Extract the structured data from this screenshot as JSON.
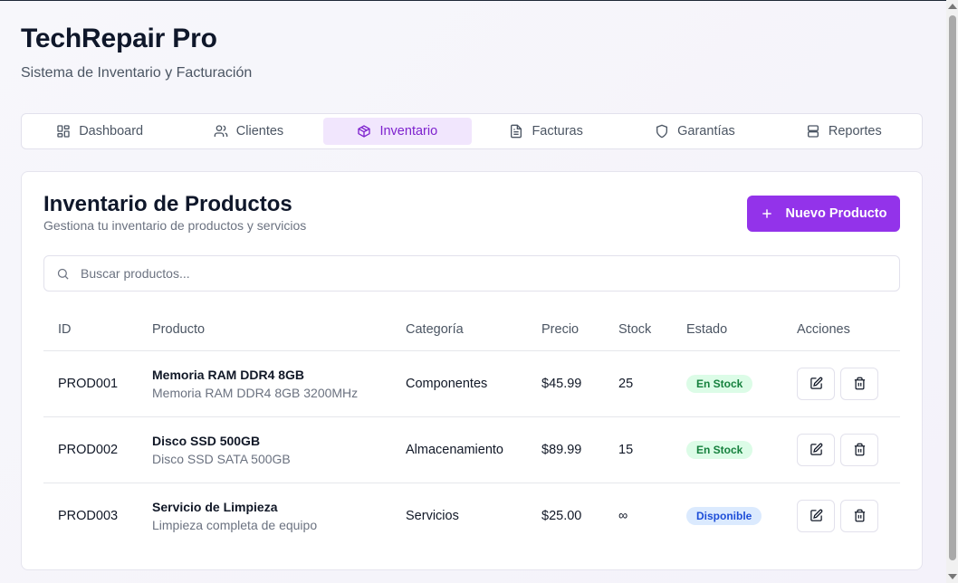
{
  "app": {
    "title": "TechRepair Pro",
    "subtitle": "Sistema de Inventario y Facturación"
  },
  "tabs": [
    {
      "label": "Dashboard",
      "icon": "grid-icon",
      "active": false
    },
    {
      "label": "Clientes",
      "icon": "users-icon",
      "active": false
    },
    {
      "label": "Inventario",
      "icon": "package-icon",
      "active": true
    },
    {
      "label": "Facturas",
      "icon": "document-icon",
      "active": false
    },
    {
      "label": "Garantías",
      "icon": "shield-icon",
      "active": false
    },
    {
      "label": "Reportes",
      "icon": "server-icon",
      "active": false
    }
  ],
  "inventory": {
    "title": "Inventario de Productos",
    "subtitle": "Gestiona tu inventario de productos y servicios",
    "new_button_label": "Nuevo Producto",
    "search_placeholder": "Buscar productos..."
  },
  "table": {
    "headers": [
      "ID",
      "Producto",
      "Categoría",
      "Precio",
      "Stock",
      "Estado",
      "Acciones"
    ],
    "rows": [
      {
        "id": "PROD001",
        "name": "Memoria RAM DDR4 8GB",
        "desc": "Memoria RAM DDR4 8GB 3200MHz",
        "category": "Componentes",
        "price": "$45.99",
        "stock": "25",
        "status": "En Stock",
        "status_kind": "stock"
      },
      {
        "id": "PROD002",
        "name": "Disco SSD 500GB",
        "desc": "Disco SSD SATA 500GB",
        "category": "Almacenamiento",
        "price": "$89.99",
        "stock": "15",
        "status": "En Stock",
        "status_kind": "stock"
      },
      {
        "id": "PROD003",
        "name": "Servicio de Limpieza",
        "desc": "Limpieza completa de equipo",
        "category": "Servicios",
        "price": "$25.00",
        "stock": "∞",
        "status": "Disponible",
        "status_kind": "avail"
      }
    ]
  },
  "colors": {
    "accent": "#9333ea",
    "active_tab_bg": "#f1e6fd",
    "badge_stock_bg": "#dcfce7",
    "badge_avail_bg": "#dbeafe"
  }
}
